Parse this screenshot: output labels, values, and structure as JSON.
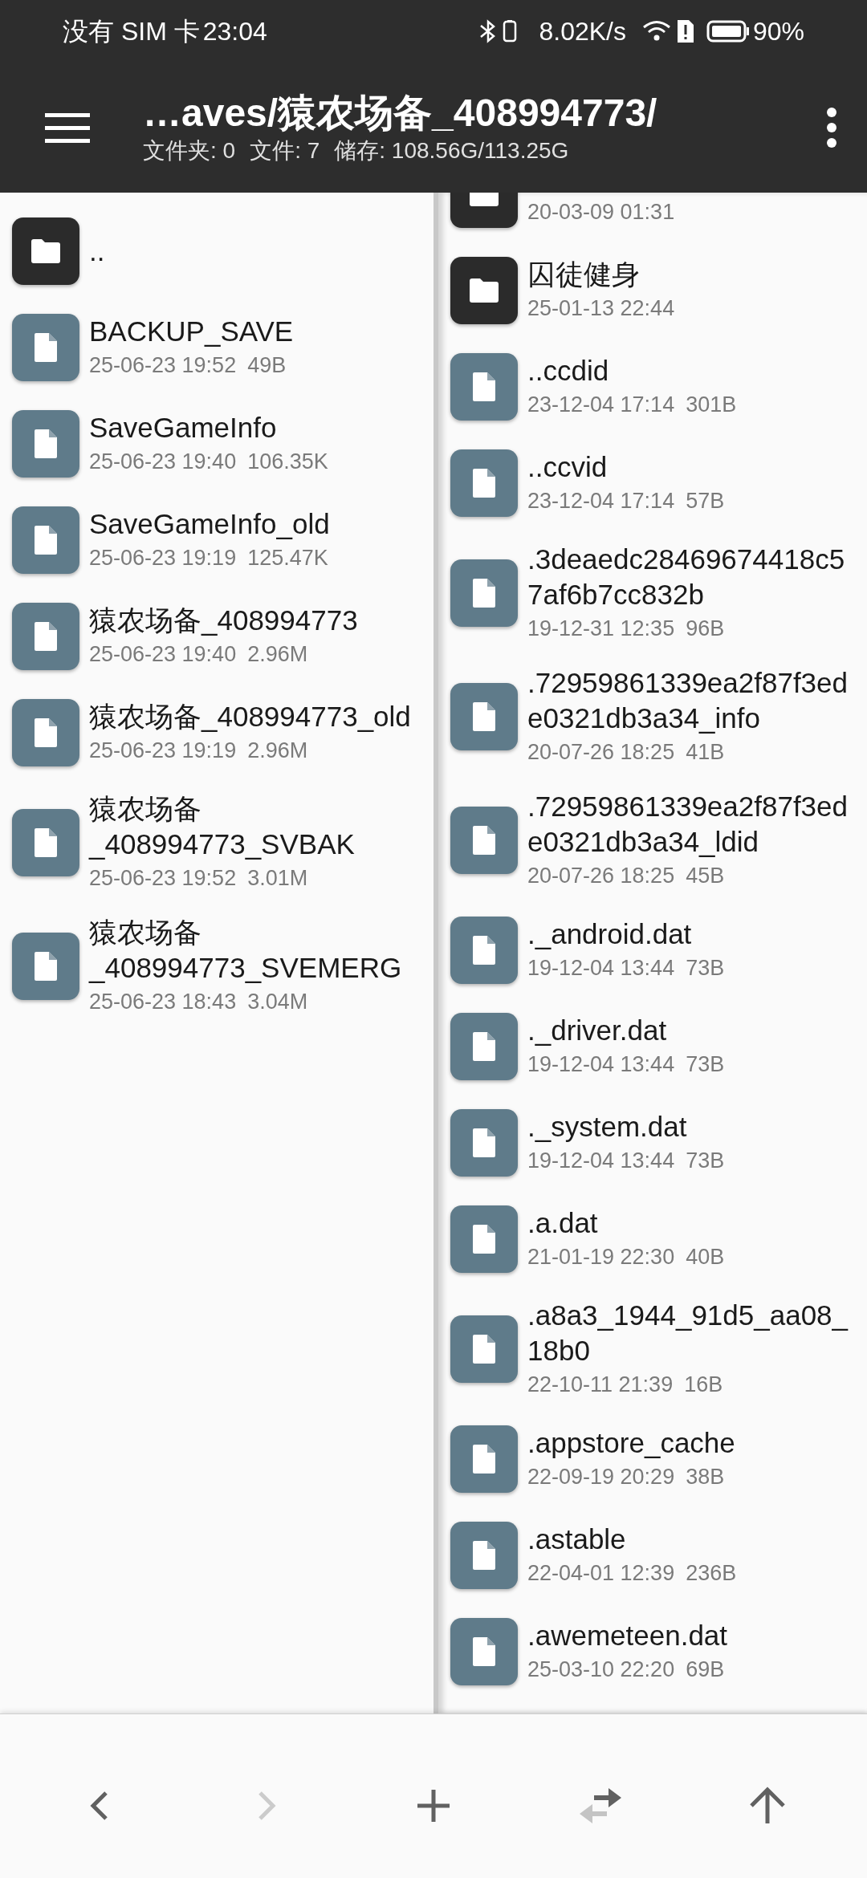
{
  "status_bar": {
    "carrier": "没有 SIM 卡",
    "time": "23:04",
    "net_speed": "8.02K/s",
    "battery": "90%"
  },
  "header": {
    "title": "…aves/猿农场备_408994773/",
    "stats": [
      "文件夹: 0",
      "文件: 7",
      "储存: 108.56G/113.25G"
    ]
  },
  "left_pane": {
    "items": [
      {
        "kind": "folder",
        "name": ".."
      },
      {
        "kind": "file",
        "name": "BACKUP_SAVE",
        "date": "25-06-23 19:52",
        "size": "49B"
      },
      {
        "kind": "file",
        "name": "SaveGameInfo",
        "date": "25-06-23 19:40",
        "size": "106.35K"
      },
      {
        "kind": "file",
        "name": "SaveGameInfo_old",
        "date": "25-06-23 19:19",
        "size": "125.47K"
      },
      {
        "kind": "file",
        "name": "猿农场备_408994773",
        "date": "25-06-23 19:40",
        "size": "2.96M"
      },
      {
        "kind": "file",
        "name": "猿农场备_408994773_old",
        "date": "25-06-23 19:19",
        "size": "2.96M"
      },
      {
        "kind": "file",
        "name": "猿农场备_408994773_SVBAK",
        "date": "25-06-23 19:52",
        "size": "3.01M"
      },
      {
        "kind": "file",
        "name": "猿农场备_408994773_SVEMERG",
        "date": "25-06-23 18:43",
        "size": "3.04M"
      }
    ]
  },
  "right_pane": {
    "items": [
      {
        "kind": "folder",
        "date": "20-03-09 01:31"
      },
      {
        "kind": "folder",
        "name": "囚徒健身",
        "date": "25-01-13 22:44"
      },
      {
        "kind": "file",
        "name": "..ccdid",
        "date": "23-12-04 17:14",
        "size": "301B"
      },
      {
        "kind": "file",
        "name": "..ccvid",
        "date": "23-12-04 17:14",
        "size": "57B"
      },
      {
        "kind": "file",
        "name": ".3deaedc28469674418c57af6b7cc832b",
        "date": "19-12-31 12:35",
        "size": "96B"
      },
      {
        "kind": "file",
        "name": ".72959861339ea2f87f3ede0321db3a34_info",
        "date": "20-07-26 18:25",
        "size": "41B"
      },
      {
        "kind": "file",
        "name": ".72959861339ea2f87f3ede0321db3a34_ldid",
        "date": "20-07-26 18:25",
        "size": "45B"
      },
      {
        "kind": "file",
        "name": "._android.dat",
        "date": "19-12-04 13:44",
        "size": "73B"
      },
      {
        "kind": "file",
        "name": "._driver.dat",
        "date": "19-12-04 13:44",
        "size": "73B"
      },
      {
        "kind": "file",
        "name": "._system.dat",
        "date": "19-12-04 13:44",
        "size": "73B"
      },
      {
        "kind": "file",
        "name": ".a.dat",
        "date": "21-01-19 22:30",
        "size": "40B"
      },
      {
        "kind": "file",
        "name": ".a8a3_1944_91d5_aa08_18b0",
        "date": "22-10-11 21:39",
        "size": "16B"
      },
      {
        "kind": "file",
        "name": ".appstore_cache",
        "date": "22-09-19 20:29",
        "size": "38B"
      },
      {
        "kind": "file",
        "name": ".astable",
        "date": "22-04-01 12:39",
        "size": "236B"
      },
      {
        "kind": "file",
        "name": ".awemeteen.dat",
        "date": "25-03-10 22:20",
        "size": "69B"
      }
    ]
  },
  "bottom_bar": [
    {
      "kind": "back",
      "disabled": false
    },
    {
      "kind": "forward",
      "disabled": true
    },
    {
      "kind": "add",
      "disabled": false
    },
    {
      "kind": "swap",
      "disabled": false
    },
    {
      "kind": "up",
      "disabled": false
    }
  ]
}
